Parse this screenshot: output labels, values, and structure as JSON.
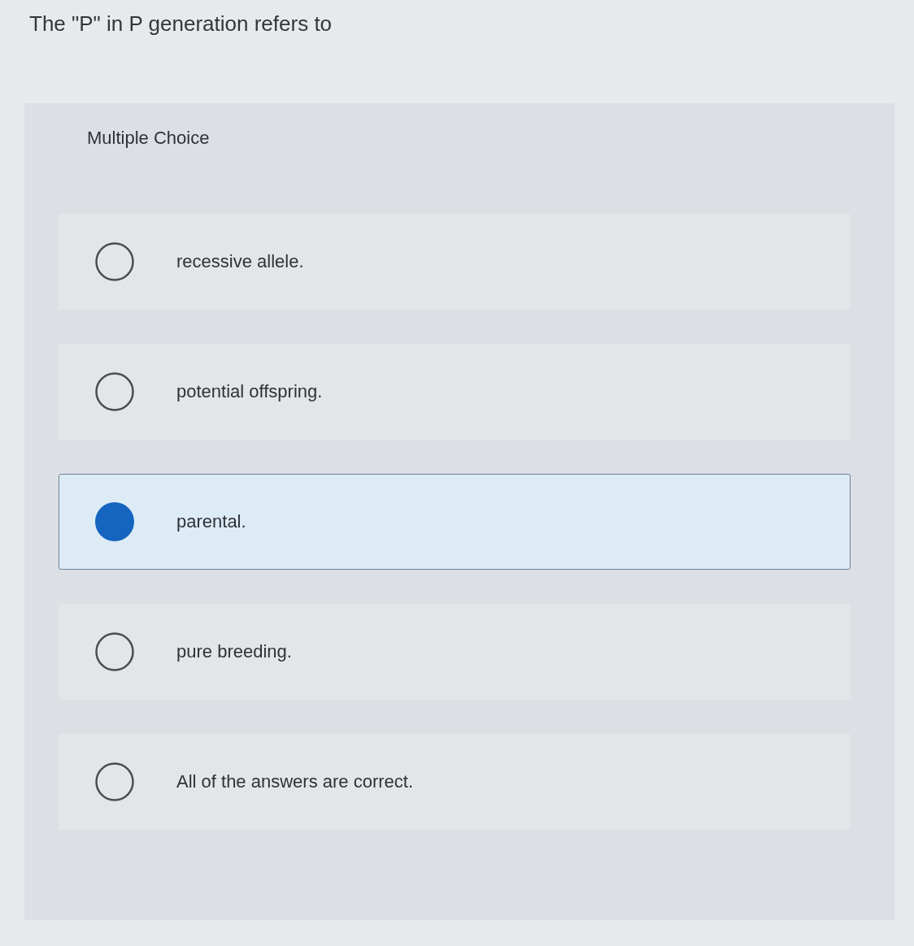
{
  "question": {
    "text": "The \"P\" in P generation refers to"
  },
  "panel": {
    "heading": "Multiple Choice"
  },
  "options": [
    {
      "label": "recessive allele.",
      "selected": false
    },
    {
      "label": "potential offspring.",
      "selected": false
    },
    {
      "label": "parental.",
      "selected": true
    },
    {
      "label": "pure breeding.",
      "selected": false
    },
    {
      "label": "All of the answers are correct.",
      "selected": false
    }
  ]
}
